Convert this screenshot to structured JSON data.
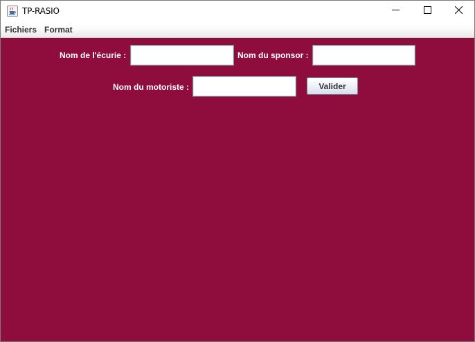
{
  "window": {
    "title": "TP-RASIO",
    "icons": {
      "app": "java-cup-icon",
      "minimize": "minimize-icon",
      "maximize": "maximize-icon",
      "close": "close-icon"
    }
  },
  "menubar": {
    "items": [
      {
        "label": "Fichiers"
      },
      {
        "label": "Format"
      }
    ]
  },
  "form": {
    "ecurie_label": "Nom de l'écurie :",
    "ecurie_value": "",
    "sponsor_label": "Nom du sponsor :",
    "sponsor_value": "",
    "motoriste_label": "Nom du motoriste :",
    "motoriste_value": "",
    "submit_label": "Valider"
  },
  "colors": {
    "background": "#8e0d3d",
    "label_text": "#ffffff"
  }
}
